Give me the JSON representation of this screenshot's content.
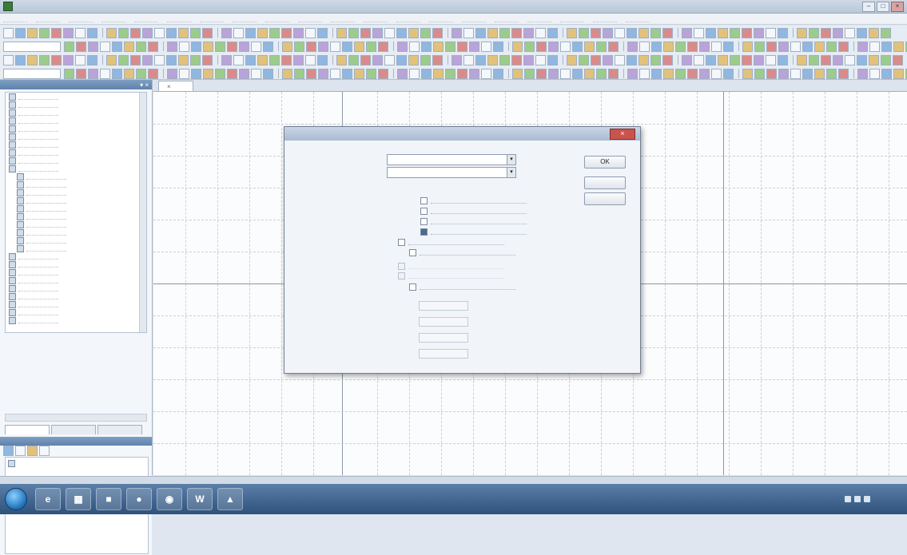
{
  "window": {
    "title": ""
  },
  "menu": [
    "",
    "",
    "",
    "",
    "",
    "",
    "",
    "",
    "",
    "",
    "",
    "",
    "",
    "",
    "",
    "",
    "",
    "",
    "",
    ""
  ],
  "left_panel": {
    "title": "",
    "tree_items": [
      "",
      "",
      "",
      "",
      "",
      "",
      "",
      "",
      "",
      "",
      "",
      "",
      "",
      "",
      "",
      "",
      "",
      "",
      "",
      "",
      "",
      "",
      "",
      "",
      "",
      "",
      "",
      "",
      ""
    ],
    "tabs": [
      "",
      "",
      ""
    ]
  },
  "properties": {
    "title": "",
    "items": [
      ""
    ]
  },
  "document": {
    "tab_label": ""
  },
  "dialog": {
    "title": "",
    "field1": {
      "label": "",
      "value": ""
    },
    "field2": {
      "label": "",
      "value": ""
    },
    "buttons": {
      "ok": "OK",
      "second": "",
      "third": ""
    },
    "group_label": "",
    "checkboxes": [
      {
        "label": "",
        "checked": false,
        "enabled": true
      },
      {
        "label": "",
        "checked": false,
        "enabled": true
      },
      {
        "label": "",
        "checked": false,
        "enabled": true
      },
      {
        "label": "",
        "checked": true,
        "enabled": true
      },
      {
        "label": "",
        "checked": false,
        "enabled": true
      },
      {
        "label": "",
        "checked": false,
        "enabled": true
      },
      {
        "label": "",
        "checked": false,
        "enabled": false
      },
      {
        "label": "",
        "checked": false,
        "enabled": false
      },
      {
        "label": "",
        "checked": false,
        "enabled": true
      }
    ],
    "lower_fields": [
      {
        "label": "",
        "value": ""
      },
      {
        "label": "",
        "value": ""
      },
      {
        "label": "",
        "value": ""
      },
      {
        "label": "",
        "value": ""
      }
    ]
  },
  "status": {
    "left": "",
    "coords": "",
    "right": ""
  },
  "taskbar": {
    "clock_time": "",
    "clock_date": ""
  }
}
